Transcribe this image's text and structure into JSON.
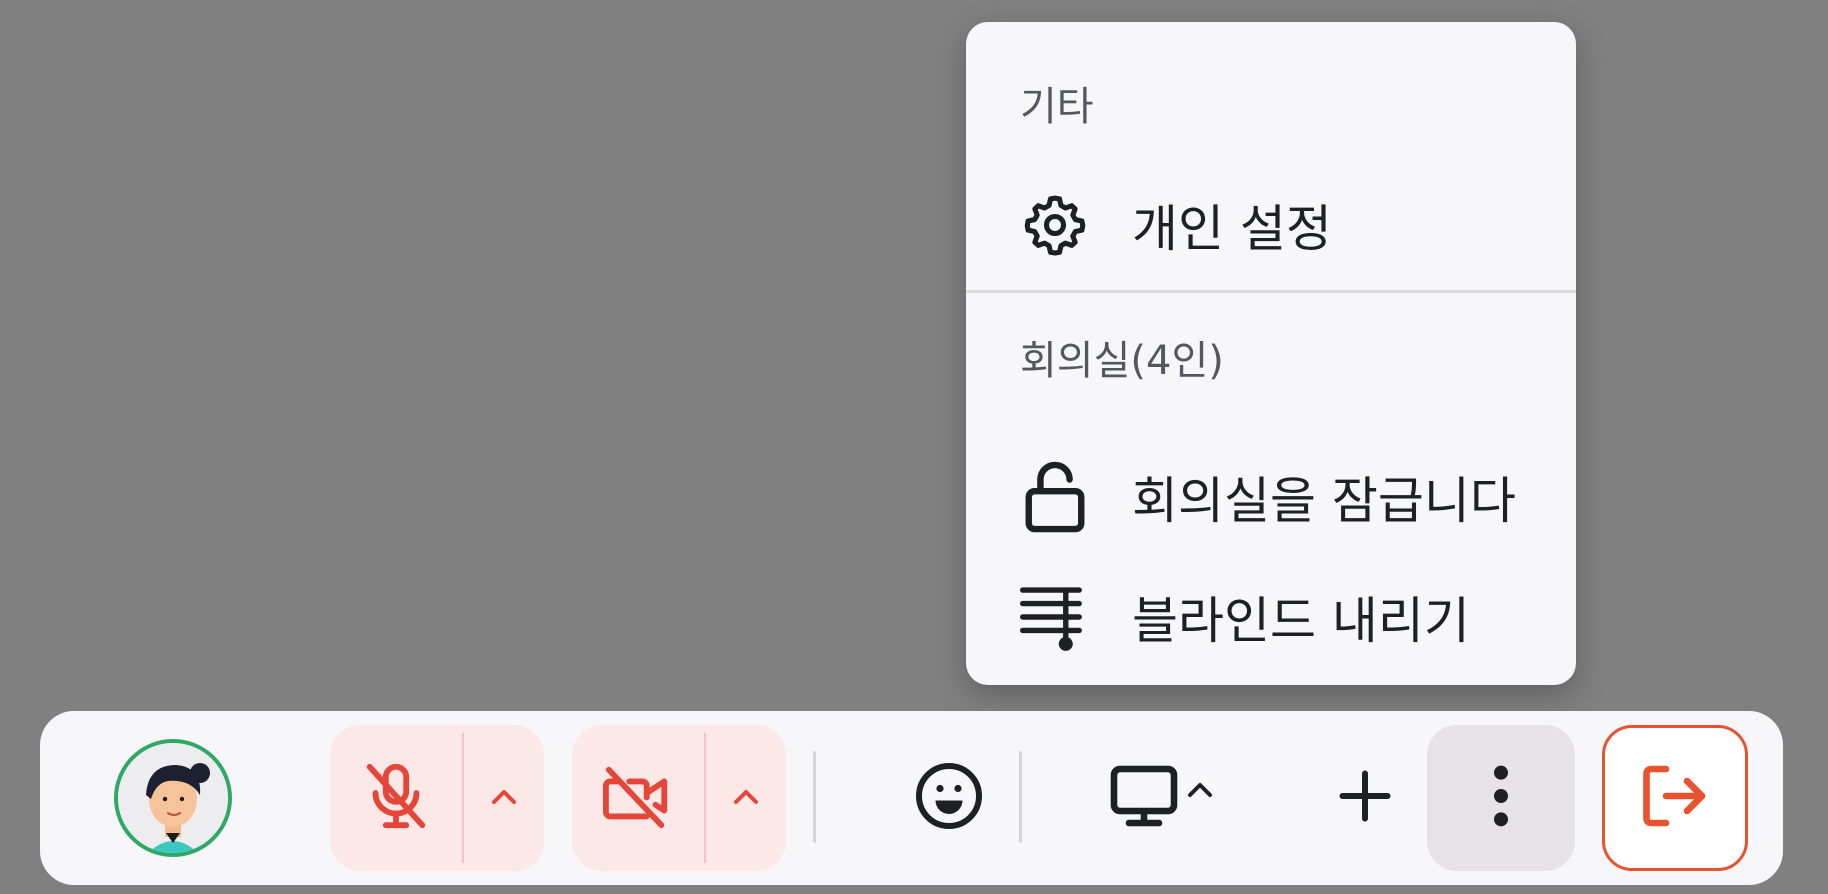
{
  "menu": {
    "section_other": "기타",
    "personal_settings": {
      "label": "개인 설정",
      "icon": "gear-icon"
    },
    "section_room": "회의실(4인)",
    "lock_room": {
      "label": "회의실을 잠급니다",
      "icon": "unlock-icon"
    },
    "lower_blind": {
      "label": "블라인드 내리기",
      "icon": "blind-icon"
    }
  },
  "toolbar": {
    "avatar": "user-avatar",
    "mic": {
      "icon": "mic-off-icon",
      "state": "off"
    },
    "camera": {
      "icon": "camera-off-icon",
      "state": "off"
    },
    "reaction_icon": "emoji-icon",
    "screen_share_icon": "monitor-icon",
    "add_icon": "plus-icon",
    "more_icon": "more-vertical-icon",
    "leave_icon": "leave-icon"
  },
  "colors": {
    "background": "#808080",
    "panel": "#f7f7f9",
    "danger": "#e5463a",
    "danger_bg": "#fde8e8",
    "leave": "#e8532f",
    "avatar_ring": "#2fa866"
  }
}
